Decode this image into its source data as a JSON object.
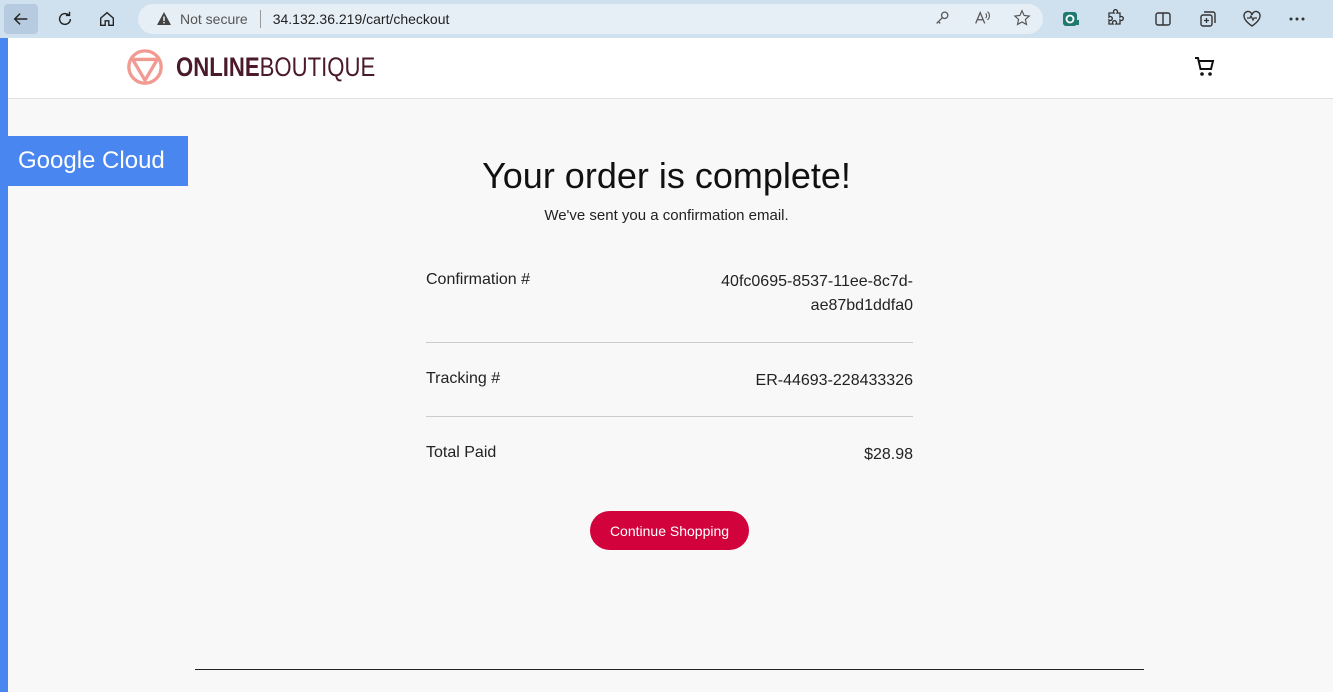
{
  "browser": {
    "security_text": "Not secure",
    "url": "34.132.36.219/cart/checkout"
  },
  "site": {
    "brand_part1": "ONLINE",
    "brand_part2": "BOUTIQUE",
    "badge": "Google Cloud",
    "accent_color": "#4a86f0",
    "logo_color": "#f19a91"
  },
  "order": {
    "title": "Your order is complete!",
    "subtitle": "We've sent you a confirmation email.",
    "rows": [
      {
        "label": "Confirmation #",
        "value_line1": "40fc0695-8537-11ee-8c7d-",
        "value_line2": "ae87bd1ddfa0"
      },
      {
        "label": "Tracking #",
        "value": "ER-44693-228433326"
      },
      {
        "label": "Total Paid",
        "value": "$28.98"
      }
    ],
    "continue_label": "Continue Shopping",
    "button_color": "#d2033c"
  },
  "icons": [
    "back-icon",
    "refresh-icon",
    "home-icon",
    "warning-icon",
    "key-icon",
    "read-aloud-icon",
    "favorite-star-icon",
    "extension-icon",
    "puzzle-icon",
    "split-screen-icon",
    "collections-icon",
    "heart-pulse-icon",
    "more-icon",
    "cart-icon"
  ]
}
